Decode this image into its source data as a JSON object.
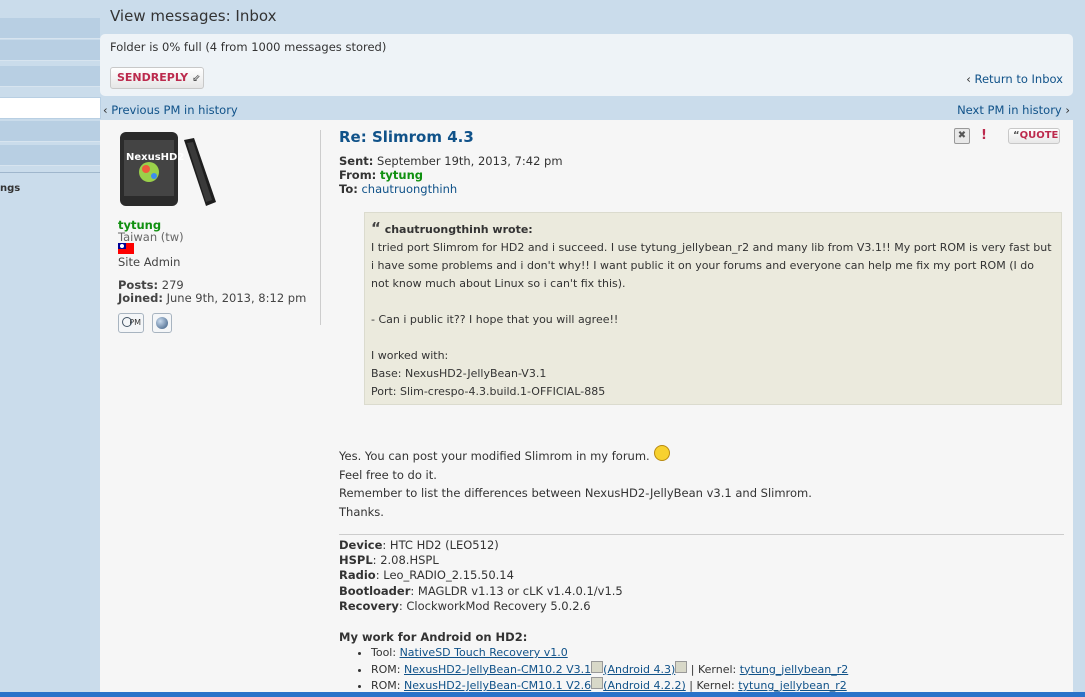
{
  "page": {
    "title": "View messages: Inbox"
  },
  "sidebar": {
    "partial_label": "ngs"
  },
  "top_panel": {
    "folder_status": "Folder is 0% full (4 from 1000 messages stored)",
    "send_reply_label": "SENDREPLY",
    "return_inbox": "Return to Inbox"
  },
  "nav": {
    "prev": "Previous PM in history",
    "next": "Next PM in history"
  },
  "profile": {
    "avatar_label": "NexusHD2",
    "username": "tytung",
    "location": "Taiwan (tw)",
    "rank": "Site Admin",
    "posts_label": "Posts:",
    "posts_value": "279",
    "joined_label": "Joined:",
    "joined_value": "June 9th, 2013, 8:12 pm",
    "pm_label": "PM"
  },
  "message": {
    "subject": "Re: Slimrom 4.3",
    "sent_label": "Sent:",
    "sent_value": "September 19th, 2013, 7:42 pm",
    "from_label": "From:",
    "from_value": "tytung",
    "to_label": "To:",
    "to_value": "chautruongthinh",
    "quote_button": "QUOTE",
    "quote": {
      "cite": "chautruongthinh wrote:",
      "lines": [
        "I tried port Slimrom for HD2 and i succeed. I use tytung_jellybean_r2 and many lib from V3.1!! My port ROM is very fast but",
        "i have some problems and i don't why!! I want public it on your forums and everyone can help me fix my port ROM (I do",
        "not know much about Linux so i can't fix this).",
        "",
        "- Can i public it?? I hope that you will agree!!",
        "",
        "I worked with:",
        "Base: NexusHD2-JellyBean-V3.1",
        "Port: Slim-crespo-4.3.build.1-OFFICIAL-885"
      ]
    },
    "reply_lines": [
      "Yes. You can post your modified Slimrom in my forum.",
      "Feel free to do it.",
      "Remember to list the differences between NexusHD2-JellyBean v3.1 and Slimrom.",
      "Thanks."
    ]
  },
  "signature": {
    "device_label": "Device",
    "device_value": ": HTC HD2 (LEO512)",
    "hspl_label": "HSPL",
    "hspl_value": ": 2.08.HSPL",
    "radio_label": "Radio",
    "radio_value": ": Leo_RADIO_2.15.50.14",
    "bootloader_label": "Bootloader",
    "bootloader_value": ": MAGLDR v1.13 or cLK v1.4.0.1/v1.5",
    "recovery_label": "Recovery",
    "recovery_value": ": ClockworkMod Recovery 5.0.2.6",
    "mywork_title": "My work for Android on HD2:",
    "items": [
      {
        "prefix": "Tool: ",
        "link": "NativeSD Touch Recovery v1.0",
        "suffix": "",
        "kernel_label": "",
        "kernel_link": ""
      },
      {
        "prefix": "ROM: ",
        "link": "NexusHD2-JellyBean-CM10.2 V3.1",
        "suffix": "(Android 4.3)",
        "kernel_label": " | Kernel: ",
        "kernel_link": "tytung_jellybean_r2"
      },
      {
        "prefix": "ROM: ",
        "link": "NexusHD2-JellyBean-CM10.1 V2.6",
        "suffix": "(Android 4.2.2)",
        "kernel_label": " | Kernel: ",
        "kernel_link": "tytung_jellybean_r2"
      }
    ]
  },
  "colors": {
    "background": "#cadceb",
    "post_background": "#f6f6f6",
    "quote_background": "#ebeadd",
    "link": "#105289",
    "username_green": "#109010",
    "button_red": "#bc2a4d"
  }
}
